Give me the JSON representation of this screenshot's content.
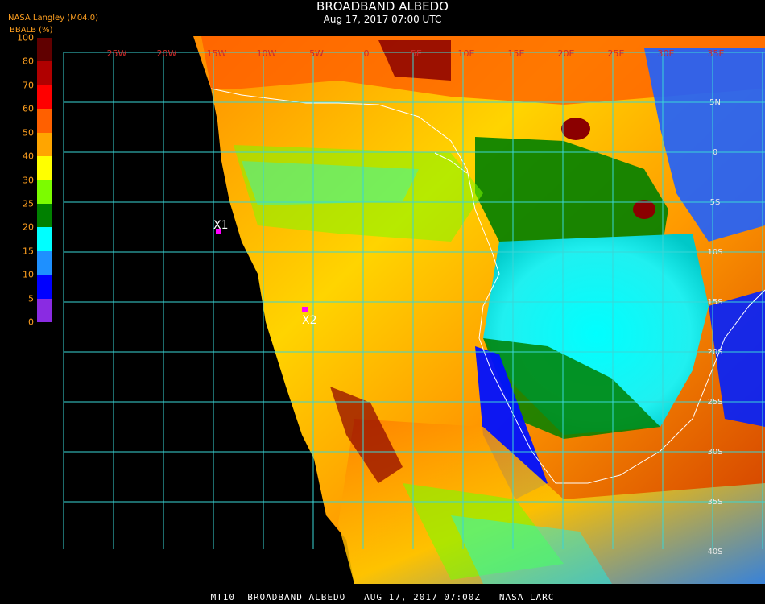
{
  "header": {
    "title": "BROADBAND ALBEDO",
    "subtitle": "Aug 17, 2017 07:00 UTC",
    "source": "NASA Langley (M04.0)"
  },
  "legend": {
    "label": "BBALB (%)",
    "ticks": [
      "0",
      "5",
      "10",
      "15",
      "20",
      "25",
      "30",
      "40",
      "50",
      "60",
      "70",
      "80",
      "100"
    ],
    "colors": [
      "#8a2be2",
      "#0000ff",
      "#1e90ff",
      "#00ffff",
      "#008000",
      "#7cfc00",
      "#ffff00",
      "#ffa500",
      "#ff6000",
      "#ff0000",
      "#b00000",
      "#600000"
    ]
  },
  "map": {
    "lon_labels": [
      "25W",
      "20W",
      "15W",
      "10W",
      "5W",
      "0",
      "5E",
      "10E",
      "15E",
      "20E",
      "25E",
      "30E",
      "35E"
    ],
    "lat_labels": [
      "5N",
      "0",
      "5S",
      "10S",
      "15S",
      "20S",
      "25S",
      "30S",
      "35S",
      "40S"
    ],
    "markers": [
      {
        "label": "X1",
        "color": "#ff00ff"
      },
      {
        "label": "X2",
        "color": "#ff00ff"
      }
    ]
  },
  "footer": "MT10  BROADBAND ALBEDO   AUG 17, 2017 07:00Z   NASA LARC"
}
